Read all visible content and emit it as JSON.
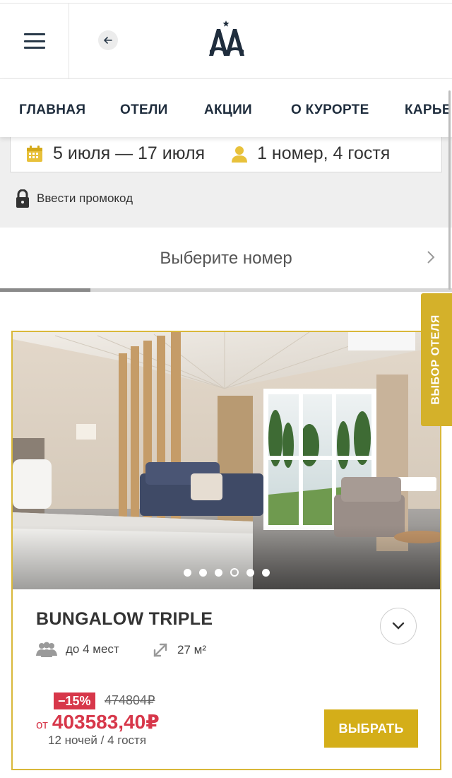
{
  "header": {
    "menu_icon": "hamburger-icon",
    "back_icon": "arrow-left-icon",
    "logo_icon": "resort-logo"
  },
  "nav": {
    "items": [
      {
        "label": "ГЛАВНАЯ"
      },
      {
        "label": "ОТЕЛИ"
      },
      {
        "label": "АКЦИИ"
      },
      {
        "label": "О КУРОРТЕ"
      },
      {
        "label": "КАРЬЕРА"
      }
    ]
  },
  "booking": {
    "dates": "5 июля — 17 июля",
    "guests": "1 номер, 4 гостя",
    "promo_label": "Ввести промокод",
    "choose_label": "Выберите номер",
    "step_progress": 0.2
  },
  "side_tab": {
    "label": "ВЫБОР ОТЕЛЯ"
  },
  "room": {
    "title": "BUNGALOW TRIPLE",
    "capacity": "до 4 мест",
    "area": "27 м²",
    "discount": "−15%",
    "old_price": "474804₽",
    "price_prefix": "от",
    "price": "403583,40₽",
    "price_note": "12 ночей / 4 гостя",
    "select_label": "ВЫБРАТЬ",
    "photo_count": 6,
    "active_photo": 4
  },
  "colors": {
    "gold": "#d4ae19",
    "red": "#d7374a",
    "navy": "#1f2d3d"
  }
}
